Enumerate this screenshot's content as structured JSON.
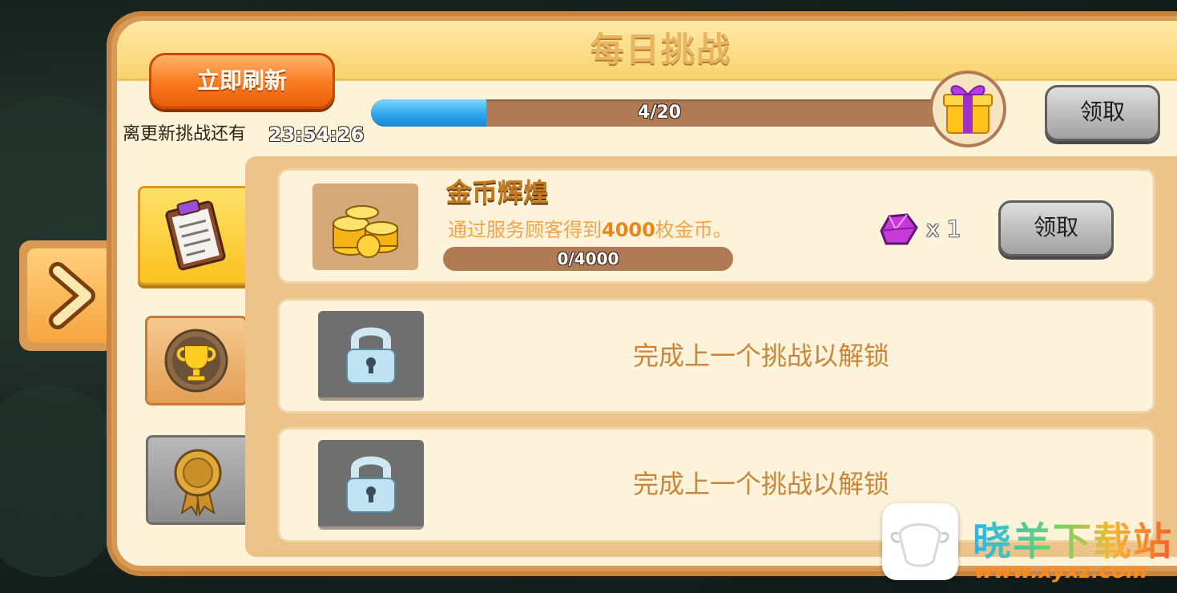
{
  "header": {
    "title": "每日挑战"
  },
  "refresh": {
    "label": "立即刷新",
    "timer_label": "离更新挑战还有",
    "timer_value": "23:54:26"
  },
  "daily_progress": {
    "text": "4/20",
    "current": 4,
    "total": 20,
    "claim_label": "领取"
  },
  "challenges": [
    {
      "title": "金币辉煌",
      "desc_pre": "通过服务顾客得到",
      "desc_num": "4000",
      "desc_post": "枚金币。",
      "progress_text": "0/4000",
      "reward_qty": "x 1",
      "claim_label": "领取"
    },
    {
      "locked_text": "完成上一个挑战以解锁"
    },
    {
      "locked_text": "完成上一个挑战以解锁"
    }
  ],
  "watermark": {
    "text": "晓羊下载站",
    "sub": "www.xyxz.com"
  },
  "colors": {
    "accent_orange": "#fa7a1e",
    "progress_blue": "#2aa3ea",
    "panel_cream": "#fdf3d9"
  }
}
